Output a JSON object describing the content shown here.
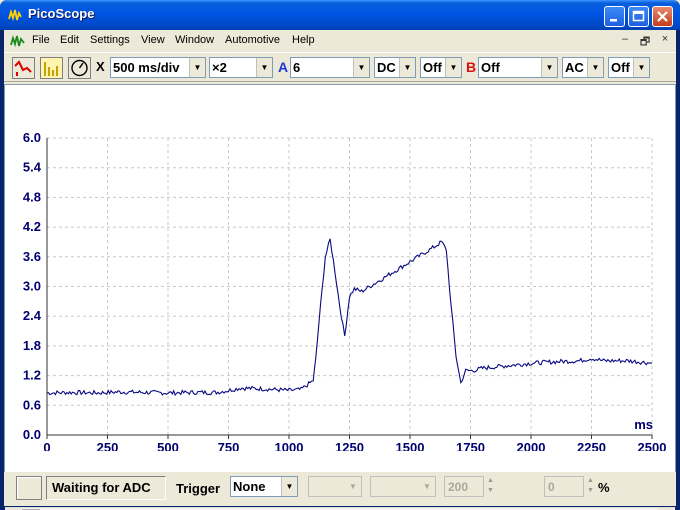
{
  "window": {
    "title": "PicoScope"
  },
  "menu": [
    "File",
    "Edit",
    "Settings",
    "View",
    "Window",
    "Automotive",
    "Help"
  ],
  "mdi_controls": [
    "–",
    "🗗",
    "×"
  ],
  "toolbar": {
    "x_label": "X",
    "timebase": "500 ms/div",
    "zoom": "×2",
    "channel_a": {
      "label": "A",
      "range": "6",
      "coupling": "DC",
      "option": "Off"
    },
    "channel_b": {
      "label": "B",
      "range": "Off",
      "coupling": "AC",
      "option": "Off"
    }
  },
  "status": {
    "message": "Waiting for ADC",
    "trigger_label": "Trigger",
    "trigger_mode": "None",
    "trigger_level": "200",
    "trigger_pct": "0",
    "pct_symbol": "%"
  },
  "colors": {
    "trace": "#0a0a80",
    "axis_text": "#00006e",
    "grid": "#c8c8c8"
  },
  "chart_data": {
    "type": "line",
    "xlabel": "ms",
    "ylabel": "",
    "xlim": [
      0,
      2500
    ],
    "ylim": [
      0,
      6.0
    ],
    "xticks": [
      "0",
      "250",
      "500",
      "750",
      "1000",
      "1250",
      "1500",
      "1750",
      "2000",
      "2250",
      "2500"
    ],
    "yticks": [
      "0.0",
      "0.6",
      "1.2",
      "1.8",
      "2.4",
      "3.0",
      "3.6",
      "4.2",
      "4.8",
      "5.4",
      "6.0"
    ],
    "grid": true,
    "series": [
      {
        "x": [
          0,
          100,
          200,
          300,
          400,
          500,
          600,
          700,
          750,
          800,
          900,
          1000,
          1050,
          1100,
          1110,
          1130,
          1150,
          1170,
          1190,
          1210,
          1230,
          1250,
          1270,
          1300,
          1350,
          1400,
          1450,
          1500,
          1550,
          1600,
          1630,
          1650,
          1670,
          1690,
          1710,
          1730,
          1760,
          1800,
          1900,
          2000,
          2100,
          2200,
          2250,
          2300,
          2400,
          2500
        ],
        "y": [
          0.85,
          0.86,
          0.85,
          0.87,
          0.86,
          0.85,
          0.86,
          0.86,
          0.9,
          0.95,
          0.93,
          0.9,
          0.92,
          1.1,
          1.5,
          2.6,
          3.6,
          3.95,
          3.3,
          2.6,
          2.0,
          2.8,
          2.95,
          2.9,
          3.05,
          3.2,
          3.35,
          3.5,
          3.65,
          3.8,
          3.9,
          3.75,
          2.6,
          1.6,
          1.05,
          1.3,
          1.3,
          1.35,
          1.4,
          1.45,
          1.48,
          1.5,
          1.55,
          1.5,
          1.5,
          1.45
        ]
      }
    ]
  }
}
